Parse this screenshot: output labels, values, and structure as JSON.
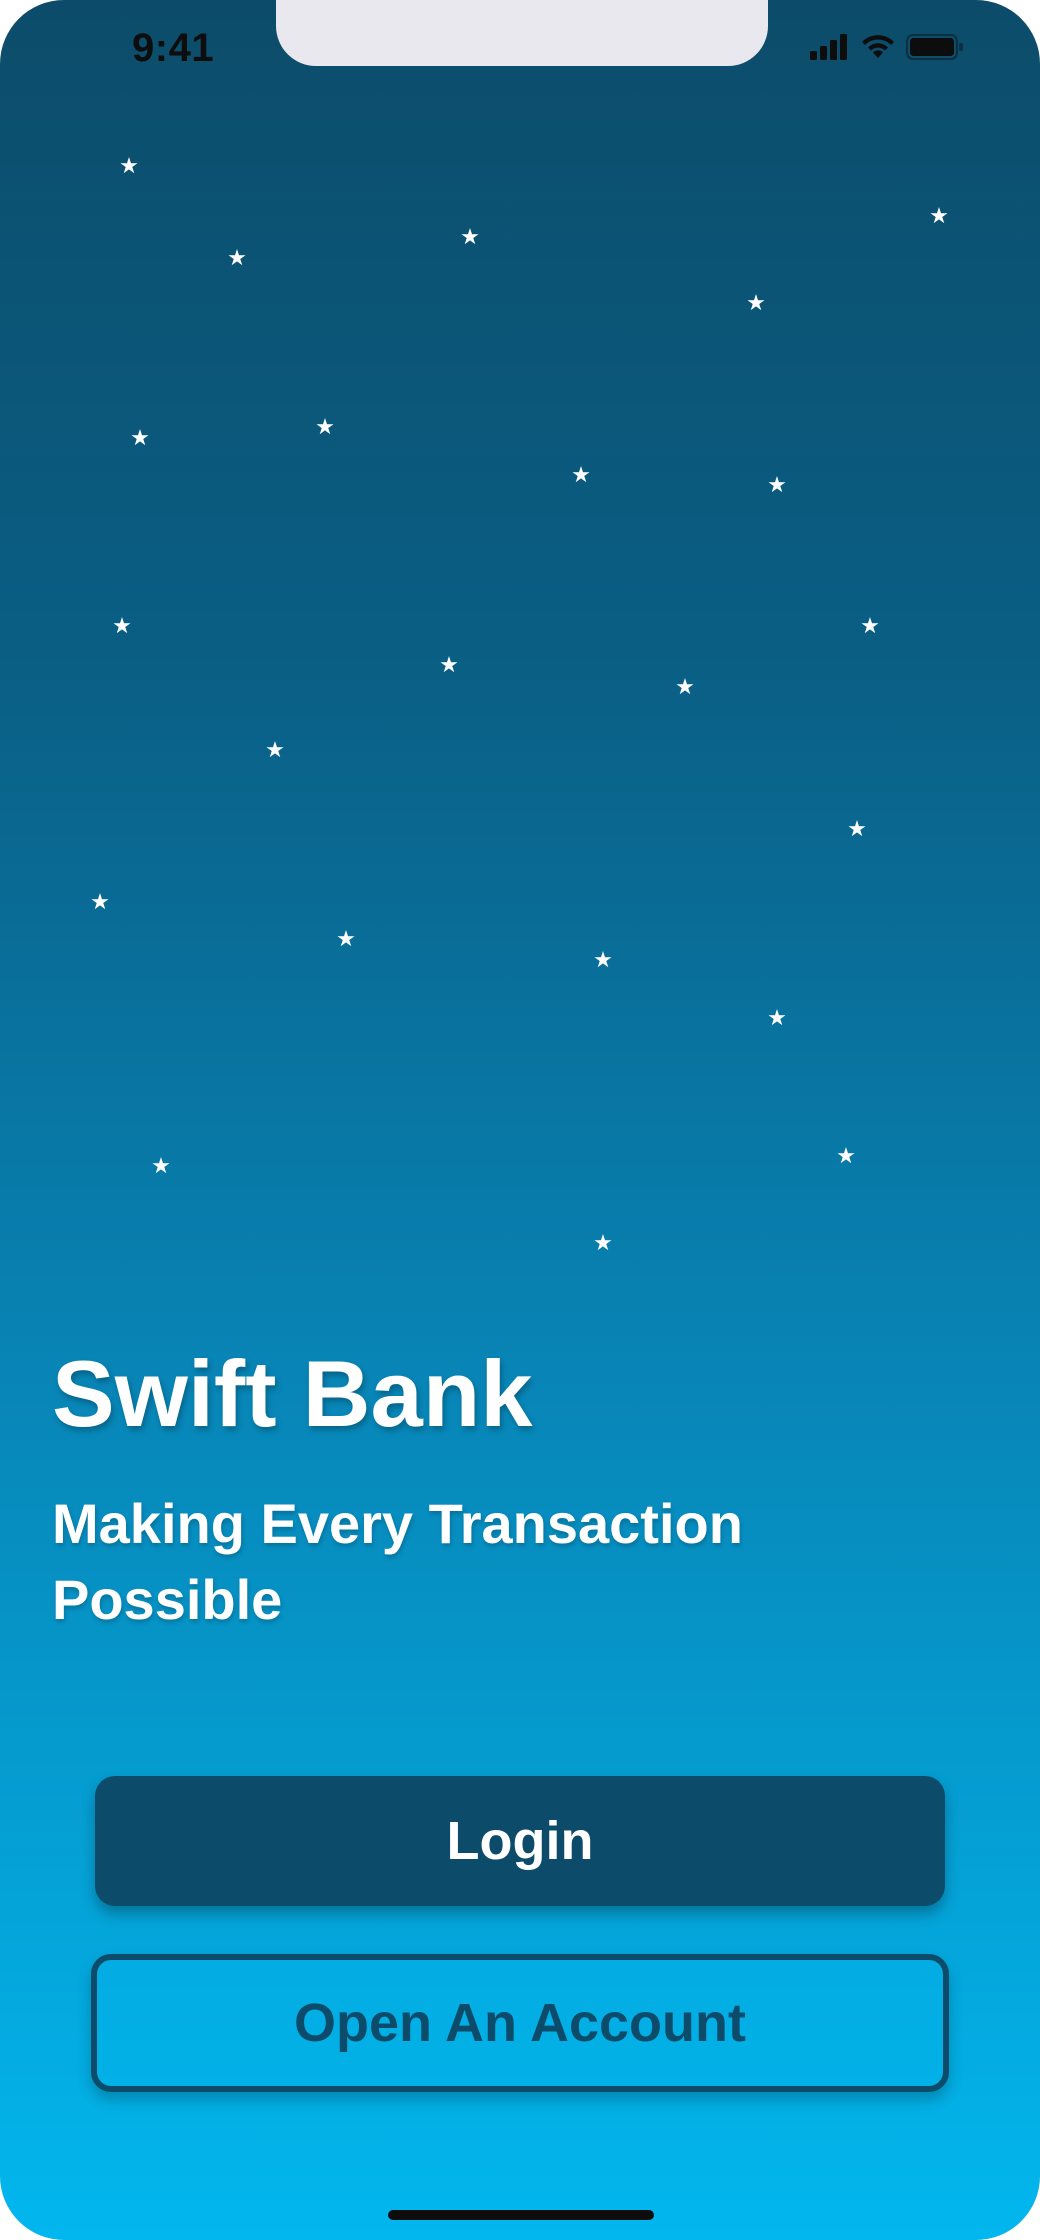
{
  "status_bar": {
    "time": "9:41",
    "icons": [
      "cellular-signal-icon",
      "wifi-icon",
      "battery-icon"
    ]
  },
  "decoration": {
    "star_glyph": "★",
    "star_color": "#ffffff"
  },
  "hero": {
    "title": "Swift Bank",
    "subtitle": "Making Every Transaction Possible"
  },
  "actions": {
    "login_label": "Login",
    "open_account_label": "Open An Account"
  },
  "colors": {
    "brand_dark": "#0c4c6a",
    "gradient_bottom": "#02b7ee",
    "text_light": "#ffffff"
  }
}
